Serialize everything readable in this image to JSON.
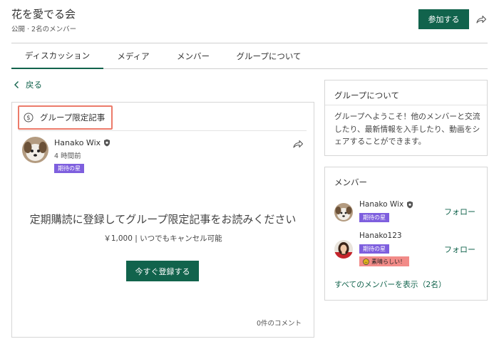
{
  "group": {
    "name": "花を愛でる会",
    "meta": "公開 · 2名のメンバー",
    "join_label": "参加する"
  },
  "tabs": [
    {
      "label": "ディスカッション",
      "active": true
    },
    {
      "label": "メディア",
      "active": false
    },
    {
      "label": "メンバー",
      "active": false
    },
    {
      "label": "グループについて",
      "active": false
    }
  ],
  "back_label": "戻る",
  "post": {
    "exclusive_label": "グループ限定記事",
    "author": "Hanako Wix",
    "time": "4 時間前",
    "badge": "期待の星",
    "subscribe_title": "定期購読に登録してグループ限定記事をお読みください",
    "price_text": "￥1,000 | いつでもキャンセル可能",
    "subscribe_button": "今すぐ登録する",
    "comments": "0件のコメント"
  },
  "about": {
    "title": "グループについて",
    "text": "グループへようこそ！他のメンバーと交流したり、最新情報を入手したり、動画をシェアすることができます。"
  },
  "members": {
    "title": "メンバー",
    "list": [
      {
        "name": "Hanako Wix",
        "badge": "期待の星",
        "follow": "フォロー"
      },
      {
        "name": "Hanako123",
        "badge": "期待の星",
        "badge2": "素晴らしい！",
        "follow": "フォロー"
      }
    ],
    "see_all": "すべてのメンバーを表示（2名）"
  },
  "colors": {
    "accent": "#11634c",
    "highlight_border": "#ec7b6a",
    "badge_purple": "#7e5fde",
    "badge_pink": "#f28b88"
  },
  "icons": [
    "share-icon",
    "chevron-left-icon",
    "dollar-circle-icon",
    "verified-icon",
    "smile-icon"
  ]
}
